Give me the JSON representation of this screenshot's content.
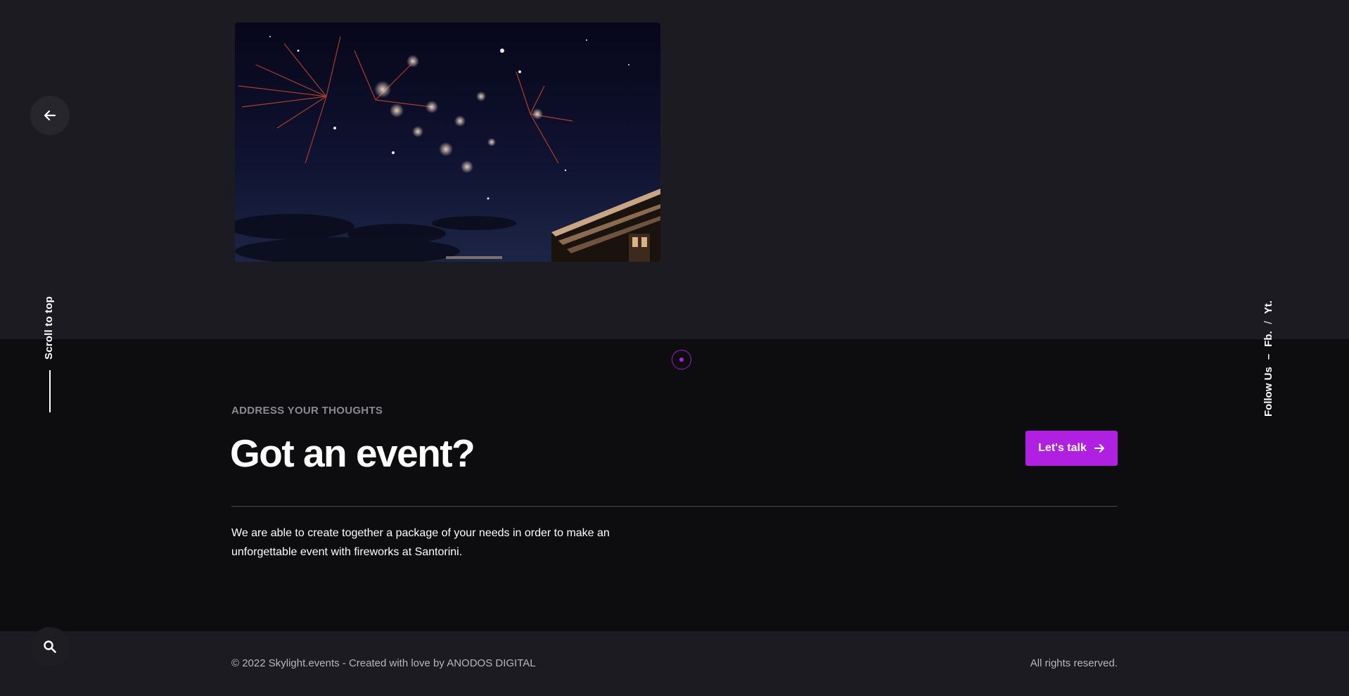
{
  "photo": {
    "alt": "Fireworks over Santorini at night"
  },
  "nav": {
    "back_icon": "arrow-left-icon",
    "search_icon": "search-icon",
    "scroll_top_label": "Scroll to top"
  },
  "follow": {
    "label": "Follow Us",
    "separator": "–",
    "links": [
      {
        "label": "Fb."
      },
      {
        "label": "Yt."
      }
    ],
    "link_separator": "/"
  },
  "event": {
    "eyebrow": "ADDRESS YOUR THOUGHTS",
    "headline": "Got an event?",
    "cta_label": "Let's talk",
    "cta_icon": "arrow-right-icon",
    "description": "We are able to create together a package of your needs in order to make an unforgettable event with fireworks at Santorini."
  },
  "footer": {
    "copyright": "© 2022 Skylight.events - Created with love by ANODOS DIGITAL",
    "rights": "All rights reserved."
  },
  "colors": {
    "accent": "#b020e0",
    "background": "#1c1b21",
    "section_dark": "#0d0c0f"
  }
}
